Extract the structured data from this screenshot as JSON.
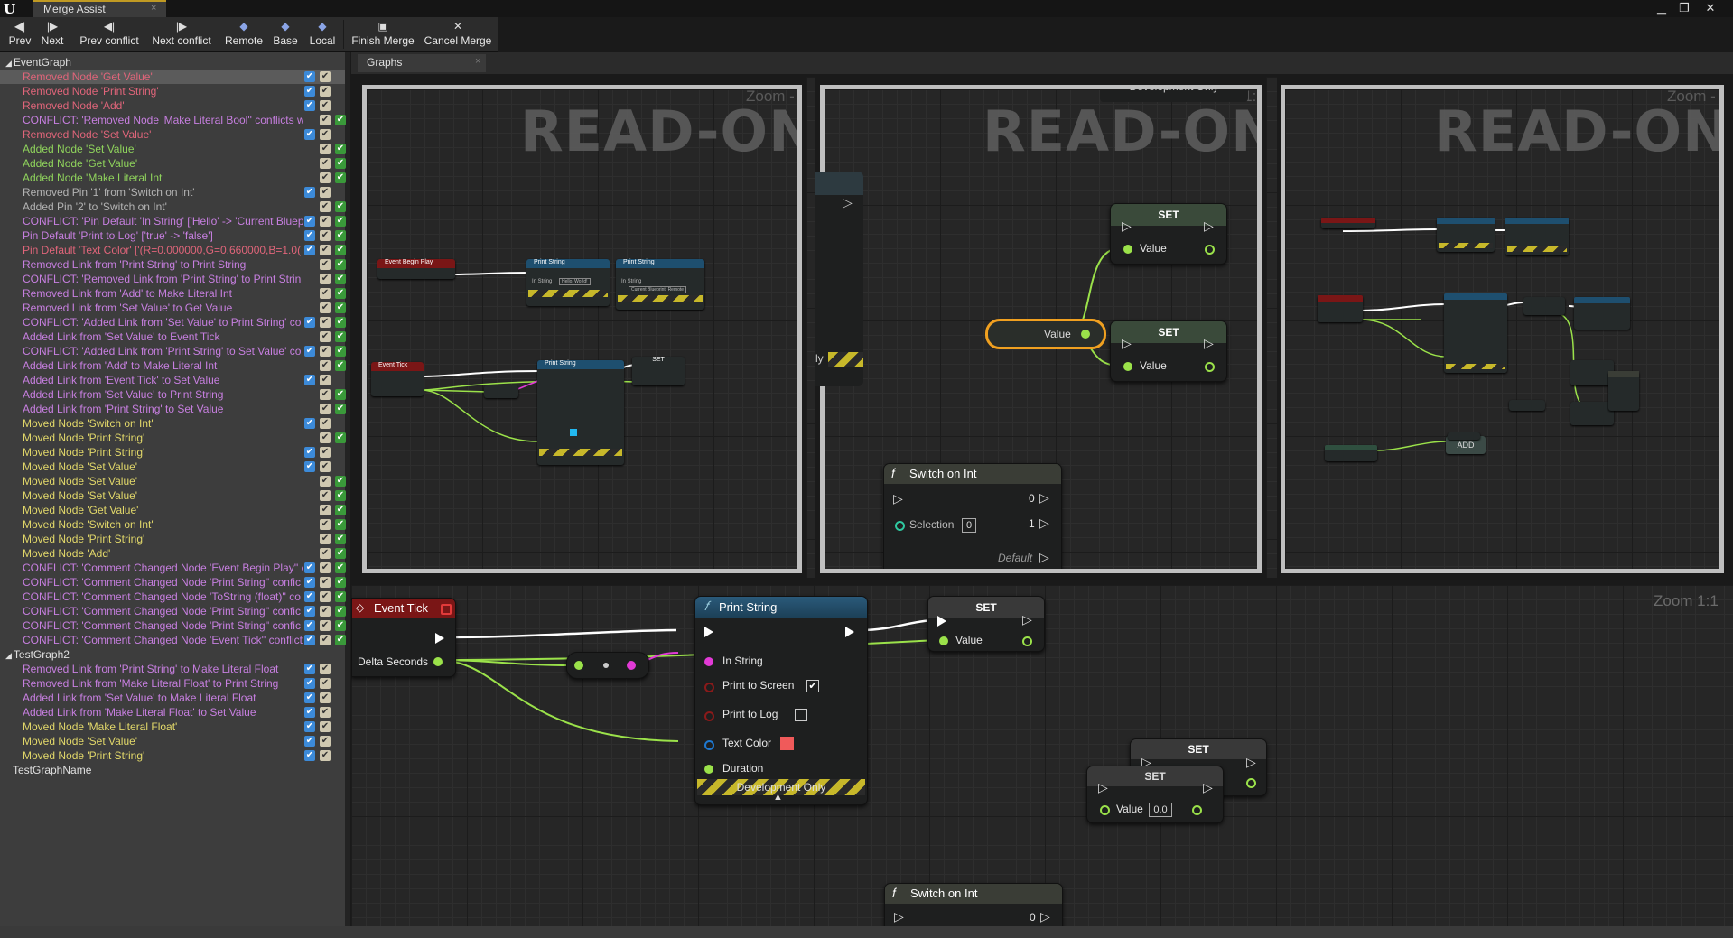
{
  "window": {
    "tab_title": "Merge Assist",
    "logo": "U",
    "close_glyph": "×",
    "buttons": [
      "minimize-icon",
      "maximize-icon",
      "close-icon"
    ],
    "button_glyphs": [
      "▁",
      "❐",
      "✕"
    ]
  },
  "toolbar": {
    "buttons": [
      {
        "label": "Prev",
        "icon": "prev-icon",
        "glyph": "◀|"
      },
      {
        "label": "Next",
        "icon": "next-icon",
        "glyph": "|▶"
      },
      {
        "label": "Prev conflict",
        "icon": "prev-conflict-icon",
        "glyph": "◀|"
      },
      {
        "label": "Next conflict",
        "icon": "next-conflict-icon",
        "glyph": "|▶"
      },
      {
        "label": "Remote",
        "icon": "remote-icon",
        "glyph": "◆"
      },
      {
        "label": "Base",
        "icon": "base-icon",
        "glyph": "◆"
      },
      {
        "label": "Local",
        "icon": "local-icon",
        "glyph": "◆"
      },
      {
        "label": "Finish Merge",
        "icon": "finish-merge-icon",
        "glyph": "▣"
      },
      {
        "label": "Cancel Merge",
        "icon": "cancel-merge-icon",
        "glyph": "✕"
      }
    ]
  },
  "colors": {
    "removed": "#e0657a",
    "added": "#8fd35c",
    "conflict": "#c77fe0",
    "moved": "#e2d86a",
    "neutral": "#b3b3b3",
    "blue_check": "#3c8ad8",
    "green_check": "#3a9a3a",
    "tan_check": "#cfc8b0"
  },
  "left_panel": {
    "categories": [
      {
        "label": "EventGraph",
        "expanded": "◢"
      },
      {
        "label": "TestGraph2",
        "expanded": "◢"
      },
      {
        "label": "TestGraphName",
        "expanded": ""
      }
    ],
    "event_graph_items": [
      {
        "text": "Removed Node 'Get Value'",
        "kind": "removed",
        "remote": "blue",
        "local": "tan",
        "selected": true
      },
      {
        "text": "Removed Node 'Print String'",
        "kind": "removed",
        "remote": "blue",
        "local": "tan"
      },
      {
        "text": "Removed Node 'Add'",
        "kind": "removed",
        "remote": "blue",
        "local": "tan"
      },
      {
        "text": "CONFLICT: 'Removed Node 'Make Literal Bool'' conflicts w",
        "kind": "conflict",
        "remote": "none",
        "local": "tan",
        "local2": "green"
      },
      {
        "text": "Removed Node 'Set Value'",
        "kind": "removed",
        "remote": "blue",
        "local": "tan"
      },
      {
        "text": "Added Node 'Set Value'",
        "kind": "added",
        "remote": "none",
        "local": "tan",
        "local2": "green"
      },
      {
        "text": "Added Node 'Get Value'",
        "kind": "added",
        "remote": "none",
        "local": "tan",
        "local2": "green"
      },
      {
        "text": "Added Node 'Make Literal Int'",
        "kind": "added",
        "remote": "none",
        "local": "tan",
        "local2": "green"
      },
      {
        "text": "Removed Pin '1' from 'Switch on Int'",
        "kind": "neutral",
        "remote": "blue",
        "local": "tan"
      },
      {
        "text": "Added Pin '2' to 'Switch on Int'",
        "kind": "neutral",
        "remote": "none",
        "local": "tan",
        "local2": "green"
      },
      {
        "text": "CONFLICT: 'Pin Default 'In String' ['Hello' -> 'Current Bluep",
        "kind": "conflict",
        "remote": "blue",
        "local": "tan",
        "local2": "green"
      },
      {
        "text": "Pin Default 'Print to Log' ['true' -> 'false']",
        "kind": "conflict",
        "remote": "blue",
        "local": "tan",
        "local2": "green"
      },
      {
        "text": "Pin Default 'Text Color' ['(R=0.000000,G=0.660000,B=1.0(",
        "kind": "removed",
        "remote": "blue",
        "local": "tan",
        "local2": "green"
      },
      {
        "text": "Removed Link from 'Print String' to Print String",
        "kind": "conflict",
        "remote": "none",
        "local": "tan",
        "local2": "green"
      },
      {
        "text": "CONFLICT: 'Removed Link from 'Print String' to Print Strin",
        "kind": "conflict",
        "remote": "none",
        "local": "tan",
        "local2": "green"
      },
      {
        "text": "Removed Link from 'Add' to Make Literal Int",
        "kind": "conflict",
        "remote": "none",
        "local": "tan",
        "local2": "green"
      },
      {
        "text": "Removed Link from 'Set Value' to Get Value",
        "kind": "conflict",
        "remote": "none",
        "local": "tan",
        "local2": "green"
      },
      {
        "text": "CONFLICT: 'Added Link from 'Set Value' to Print String' co",
        "kind": "conflict",
        "remote": "blue",
        "local": "tan",
        "local2": "green"
      },
      {
        "text": "Added Link from 'Set Value' to Event Tick",
        "kind": "conflict",
        "remote": "none",
        "local": "tan",
        "local2": "green"
      },
      {
        "text": "CONFLICT: 'Added Link from 'Print String' to Set Value' co",
        "kind": "conflict",
        "remote": "blue",
        "local": "tan",
        "local2": "green"
      },
      {
        "text": "Added Link from 'Add' to Make Literal Int",
        "kind": "conflict",
        "remote": "none",
        "local": "tan",
        "local2": "green"
      },
      {
        "text": "Added Link from 'Event Tick' to Set Value",
        "kind": "conflict",
        "remote": "blue",
        "local": "tan"
      },
      {
        "text": "Added Link from 'Set Value' to Print String",
        "kind": "conflict",
        "remote": "none",
        "local": "tan",
        "local2": "green"
      },
      {
        "text": "Added Link from 'Print String' to Set Value",
        "kind": "conflict",
        "remote": "none",
        "local": "tan",
        "local2": "green"
      },
      {
        "text": "Moved Node 'Switch on Int'",
        "kind": "moved",
        "remote": "blue",
        "local": "tan"
      },
      {
        "text": "Moved Node 'Print String'",
        "kind": "moved",
        "remote": "none",
        "local": "tan",
        "local2": "green"
      },
      {
        "text": "Moved Node 'Print String'",
        "kind": "moved",
        "remote": "blue",
        "local": "tan"
      },
      {
        "text": "Moved Node 'Set Value'",
        "kind": "moved",
        "remote": "blue",
        "local": "tan"
      },
      {
        "text": "Moved Node 'Set Value'",
        "kind": "moved",
        "remote": "none",
        "local": "tan",
        "local2": "green"
      },
      {
        "text": "Moved Node 'Set Value'",
        "kind": "moved",
        "remote": "none",
        "local": "tan",
        "local2": "green"
      },
      {
        "text": "Moved Node 'Get Value'",
        "kind": "moved",
        "remote": "none",
        "local": "tan",
        "local2": "green"
      },
      {
        "text": "Moved Node 'Switch on Int'",
        "kind": "moved",
        "remote": "none",
        "local": "tan",
        "local2": "green"
      },
      {
        "text": "Moved Node 'Print String'",
        "kind": "moved",
        "remote": "none",
        "local": "tan",
        "local2": "green"
      },
      {
        "text": "Moved Node 'Add'",
        "kind": "moved",
        "remote": "none",
        "local": "tan",
        "local2": "green"
      },
      {
        "text": "CONFLICT: 'Comment Changed Node 'Event Begin Play'' c",
        "kind": "conflict",
        "remote": "blue",
        "local": "tan",
        "local2": "green"
      },
      {
        "text": "CONFLICT: 'Comment Changed Node 'Print String'' confic",
        "kind": "conflict",
        "remote": "blue",
        "local": "tan",
        "local2": "green"
      },
      {
        "text": "CONFLICT: 'Comment Changed Node 'ToString (float)'' co",
        "kind": "conflict",
        "remote": "blue",
        "local": "tan",
        "local2": "green"
      },
      {
        "text": "CONFLICT: 'Comment Changed Node 'Print String'' confic",
        "kind": "conflict",
        "remote": "blue",
        "local": "tan",
        "local2": "green"
      },
      {
        "text": "CONFLICT: 'Comment Changed Node 'Print String'' confic",
        "kind": "conflict",
        "remote": "blue",
        "local": "tan",
        "local2": "green"
      },
      {
        "text": "CONFLICT: 'Comment Changed Node 'Event Tick'' conflict",
        "kind": "conflict",
        "remote": "blue",
        "local": "tan",
        "local2": "green"
      }
    ],
    "test_graph2_items": [
      {
        "text": "Removed Link from 'Print String' to Make Literal Float",
        "kind": "conflict",
        "remote": "blue",
        "local": "tan"
      },
      {
        "text": "Removed Link from 'Make Literal Float' to Print String",
        "kind": "conflict",
        "remote": "blue",
        "local": "tan"
      },
      {
        "text": "Added Link from 'Set Value' to Make Literal Float",
        "kind": "conflict",
        "remote": "blue",
        "local": "tan"
      },
      {
        "text": "Added Link from 'Make Literal Float' to Set Value",
        "kind": "conflict",
        "remote": "blue",
        "local": "tan"
      },
      {
        "text": "Moved Node 'Make Literal Float'",
        "kind": "moved",
        "remote": "blue",
        "local": "tan"
      },
      {
        "text": "Moved Node 'Set Value'",
        "kind": "moved",
        "remote": "blue",
        "local": "tan"
      },
      {
        "text": "Moved Node 'Print String'",
        "kind": "moved",
        "remote": "blue",
        "local": "tan"
      }
    ],
    "checkmark": "✔"
  },
  "graphs": {
    "tab_label": "Graphs",
    "tab_close": "×",
    "read_only": "READ-ONLY",
    "zoom_labels": [
      "Zoom -",
      "Zoom 1:",
      "Zoom -",
      "Zoom 1:1"
    ],
    "dev_only_top": "Development Only",
    "dev_only": "Development Only",
    "nodes": {
      "event_begin_play": "Event Begin Play",
      "print_string": "Print String",
      "event_tick": "Event Tick",
      "set": "SET",
      "value": "Value",
      "switch_on_int": "Switch on Int",
      "selection": "Selection",
      "selection_value": "0",
      "out0": "0",
      "out1": "1",
      "default": "Default",
      "delta_seconds": "Delta Seconds",
      "in_string": "In String",
      "print_to_screen": "Print to Screen",
      "print_to_log": "Print to Log",
      "text_color": "Text Color",
      "duration": "Duration",
      "value_default": "0.0",
      "add": "ADD",
      "make_literal": "Make Literal Int",
      "ly": "ly",
      "tiny_in_string": "In String",
      "tiny_hello": "Hello, World!",
      "tiny_current": "Current Blueprint: Remote"
    },
    "text_color_value": "#f05a5a"
  }
}
